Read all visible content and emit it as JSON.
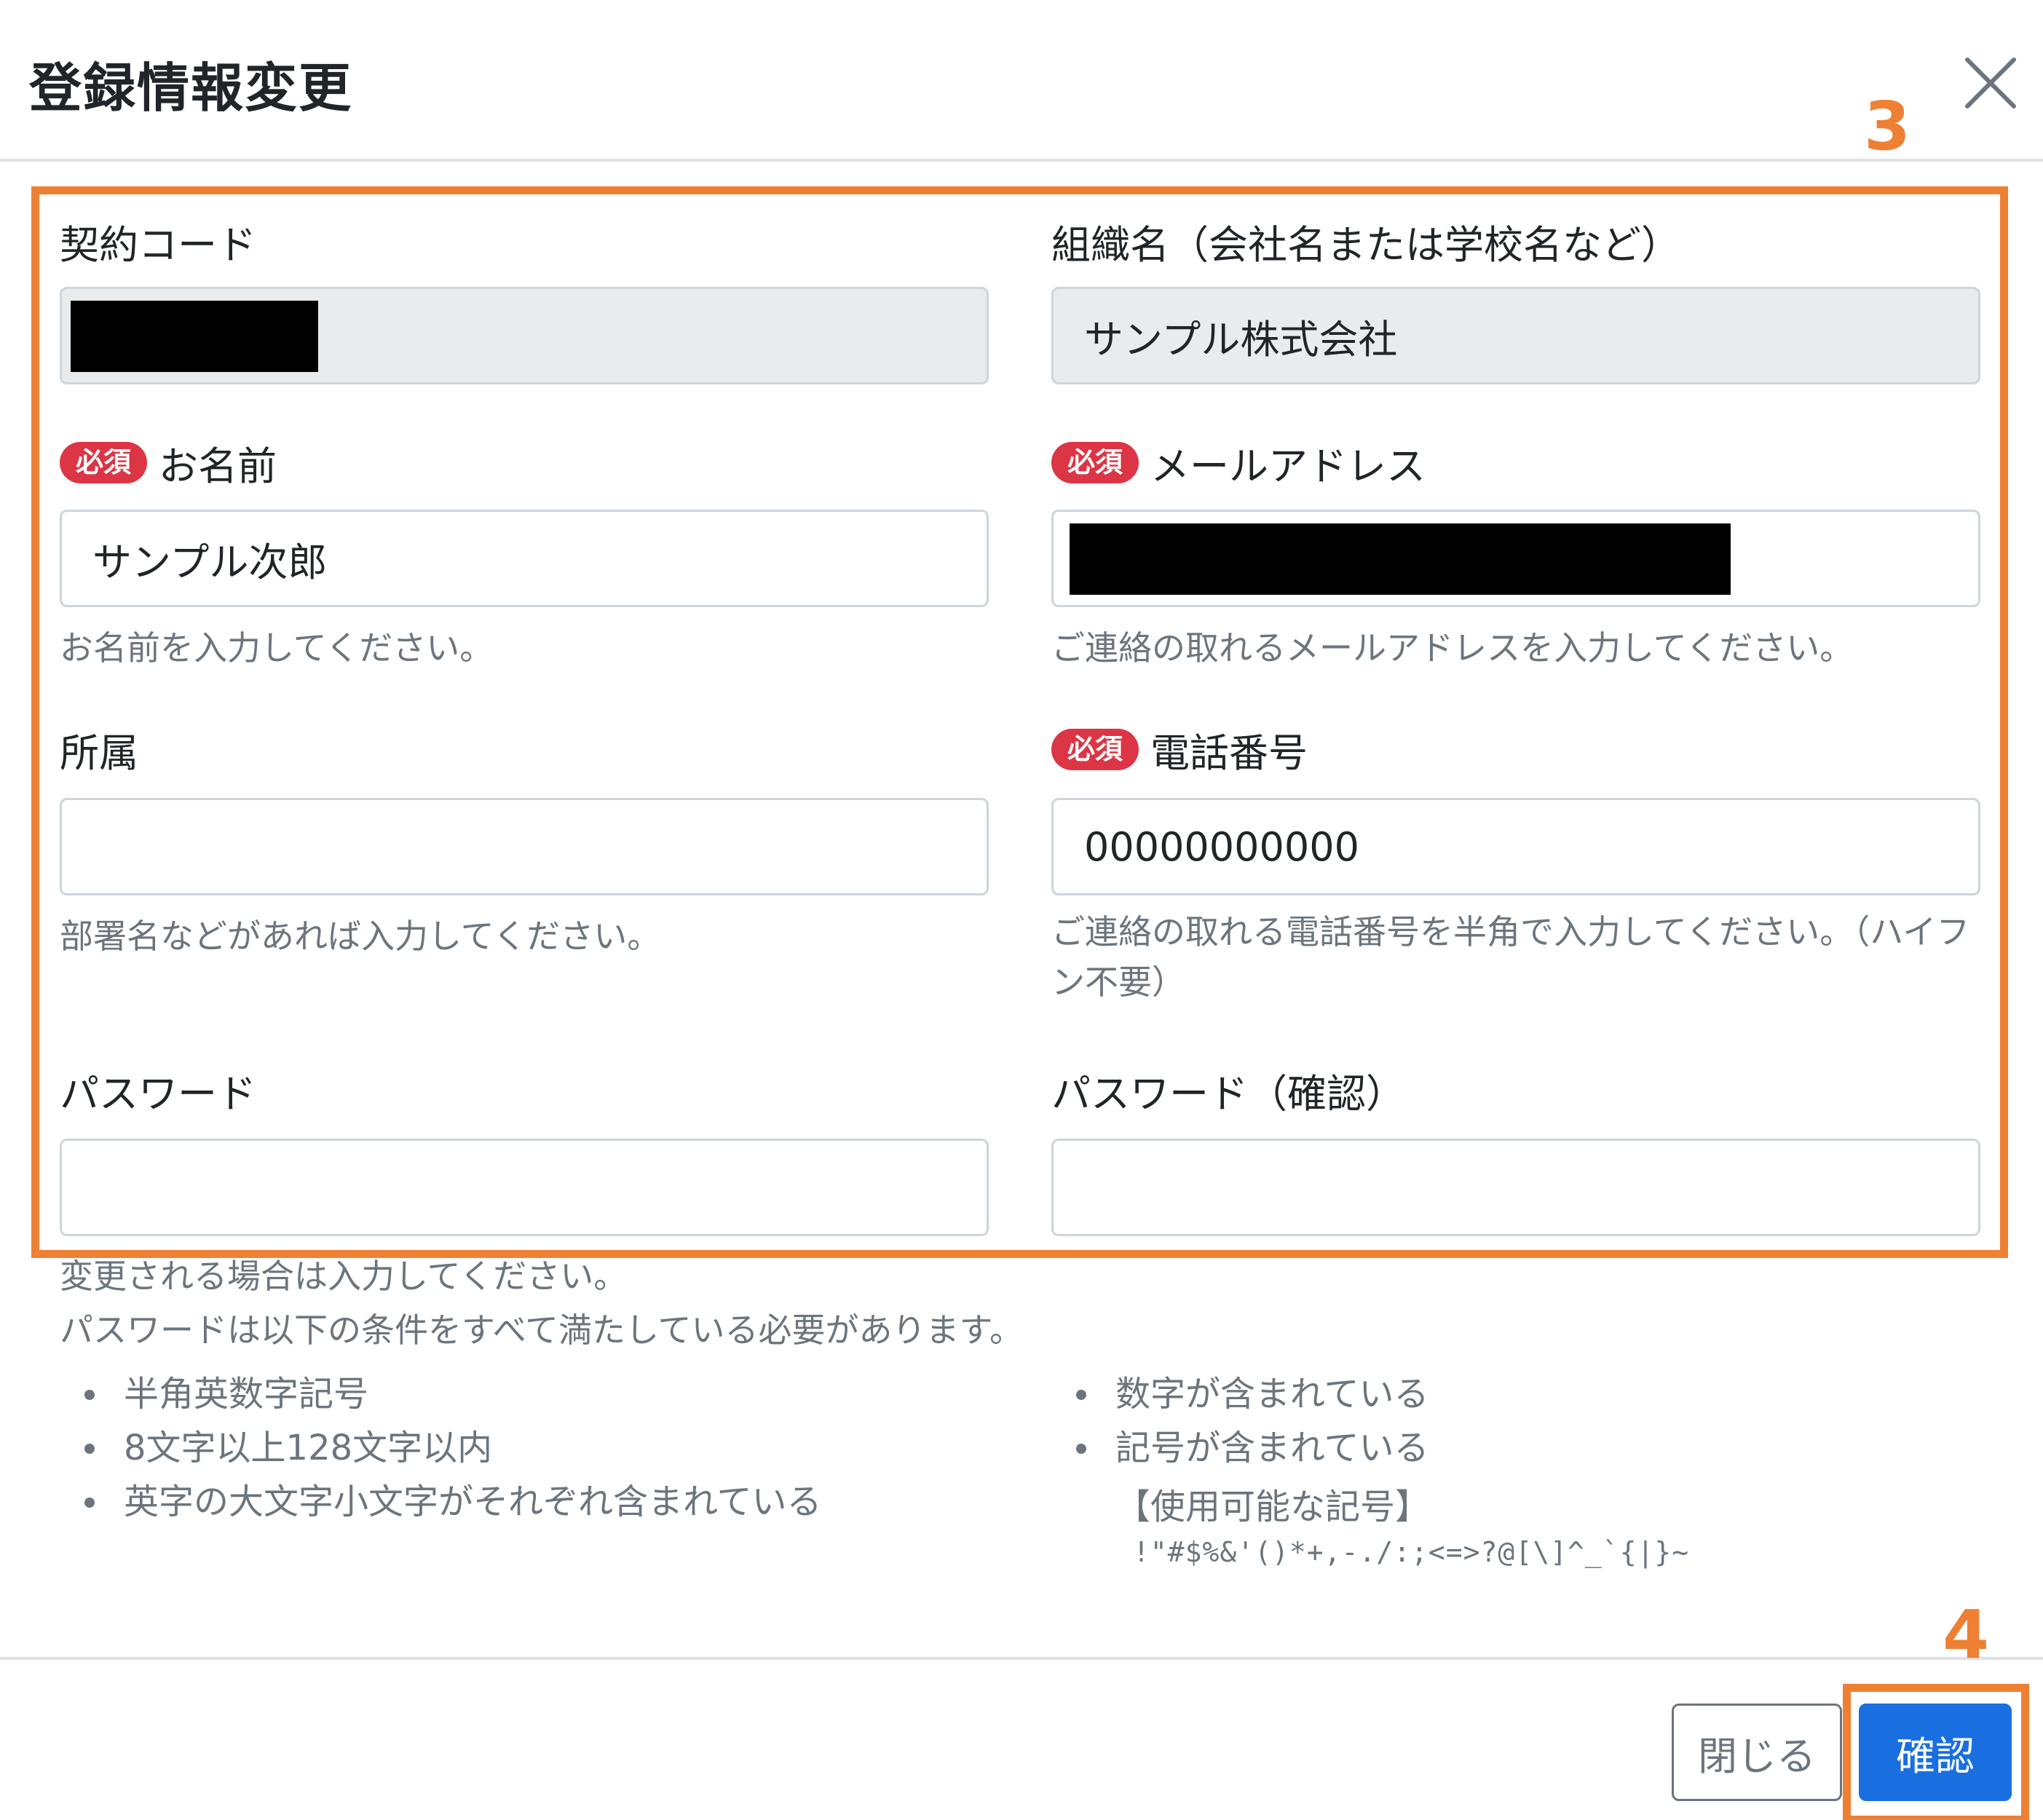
{
  "modal": {
    "title": "登録情報変更",
    "close_icon": "close-icon"
  },
  "annotations": {
    "step3": "3",
    "step4": "4",
    "color": "#ee8034"
  },
  "fields": {
    "contract_code": {
      "label": "契約コード",
      "value": ""
    },
    "organization": {
      "label": "組織名（会社名または学校名など）",
      "value": "サンプル株式会社"
    },
    "name": {
      "required": "必須",
      "label": "お名前",
      "value": "サンプル次郎",
      "help": "お名前を入力してください。"
    },
    "email": {
      "required": "必須",
      "label": "メールアドレス",
      "value": "",
      "help": "ご連絡の取れるメールアドレスを入力してください。"
    },
    "department": {
      "label": "所属",
      "value": "",
      "help": "部署名などがあれば入力してください。"
    },
    "phone": {
      "required": "必須",
      "label": "電話番号",
      "value": "00000000000",
      "help": "ご連絡の取れる電話番号を半角で入力してください。（ハイフン不要）"
    },
    "password": {
      "label": "パスワード",
      "value": ""
    },
    "password_confirm": {
      "label": "パスワード（確認）",
      "value": ""
    }
  },
  "password_help": {
    "line1": "変更される場合は入力してください。",
    "line2": "パスワードは以下の条件をすべて満たしている必要があります。",
    "rules_left": [
      "半角英数字記号",
      "8文字以上128文字以内",
      "英字の大文字小文字がそれぞれ含まれている"
    ],
    "rules_right": [
      "数字が含まれている",
      "記号が含まれている"
    ],
    "symbols_title": "【使用可能な記号】",
    "symbols": "!\"#$%&'()*+,-./:;<=>?@[\\]^_`{|}~"
  },
  "footer": {
    "close_label": "閉じる",
    "confirm_label": "確認"
  },
  "colors": {
    "required_badge": "#dc3545",
    "primary": "#1a6fe0",
    "readonly_bg": "#e9ecef",
    "help_text": "#6c757d"
  }
}
